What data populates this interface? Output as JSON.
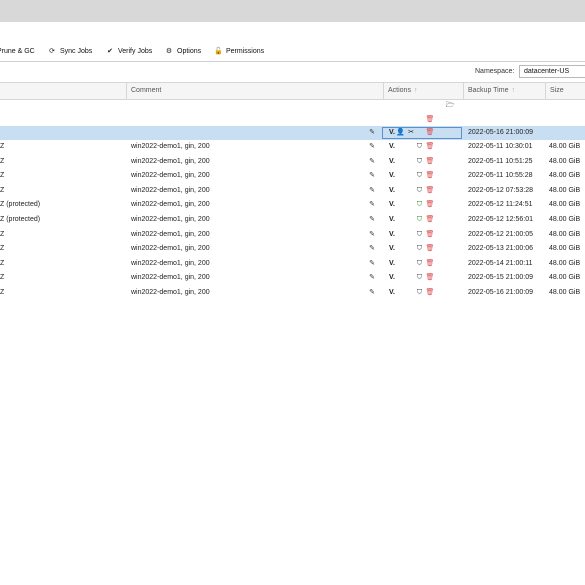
{
  "toolbar": {
    "prune_label": "Prune & GC",
    "sync_label": "Sync Jobs",
    "verify_label": "Verify Jobs",
    "options_label": "Options",
    "permissions_label": "Permissions"
  },
  "namespace": {
    "label": "Namespace:",
    "value": "datacenter-US"
  },
  "columns": {
    "comment": "Comment",
    "actions": "Actions",
    "backup_time": "Backup Time",
    "size": "Size",
    "sort_arrow": "↑"
  },
  "rows": [
    {
      "name": "",
      "comment": "",
      "time": "",
      "size": ""
    },
    {
      "name": "",
      "comment": "",
      "time": "",
      "size": ""
    },
    {
      "name": "",
      "comment": "",
      "time": "2022-05-16 21:00:09",
      "size": ""
    },
    {
      "name": "Z",
      "comment": "win2022-demo1, gin, 200",
      "time": "2022-05-11 10:30:01",
      "size": "48.00 GiB"
    },
    {
      "name": "Z",
      "comment": "win2022-demo1, gin, 200",
      "time": "2022-05-11 10:51:25",
      "size": "48.00 GiB"
    },
    {
      "name": "Z",
      "comment": "win2022-demo1, gin, 200",
      "time": "2022-05-11 10:55:28",
      "size": "48.00 GiB"
    },
    {
      "name": "Z",
      "comment": "win2022-demo1, gin, 200",
      "time": "2022-05-12 07:53:28",
      "size": "48.00 GiB"
    },
    {
      "name": "Z (protected)",
      "comment": "win2022-demo1, gin, 200",
      "time": "2022-05-12 11:24:51",
      "size": "48.00 GiB"
    },
    {
      "name": "Z (protected)",
      "comment": "win2022-demo1, gin, 200",
      "time": "2022-05-12 12:56:01",
      "size": "48.00 GiB"
    },
    {
      "name": "Z",
      "comment": "win2022-demo1, gin, 200",
      "time": "2022-05-12 21:00:05",
      "size": "48.00 GiB"
    },
    {
      "name": "Z",
      "comment": "win2022-demo1, gin, 200",
      "time": "2022-05-13 21:00:06",
      "size": "48.00 GiB"
    },
    {
      "name": "Z",
      "comment": "win2022-demo1, gin, 200",
      "time": "2022-05-14 21:00:11",
      "size": "48.00 GiB"
    },
    {
      "name": "Z",
      "comment": "win2022-demo1, gin, 200",
      "time": "2022-05-15 21:00:09",
      "size": "48.00 GiB"
    },
    {
      "name": "Z",
      "comment": "win2022-demo1, gin, 200",
      "time": "2022-05-16 21:00:09",
      "size": "48.00 GiB"
    }
  ],
  "glyphs": {
    "pencil": "✎",
    "verify": "V.",
    "shield": "⛉",
    "trash": "🗑",
    "folder": "🗁",
    "user": "👤",
    "scissors": "✂"
  },
  "colors": {
    "selection": "#c8def3",
    "protected": "#2c8a2c",
    "delete": "#d94a4a"
  }
}
